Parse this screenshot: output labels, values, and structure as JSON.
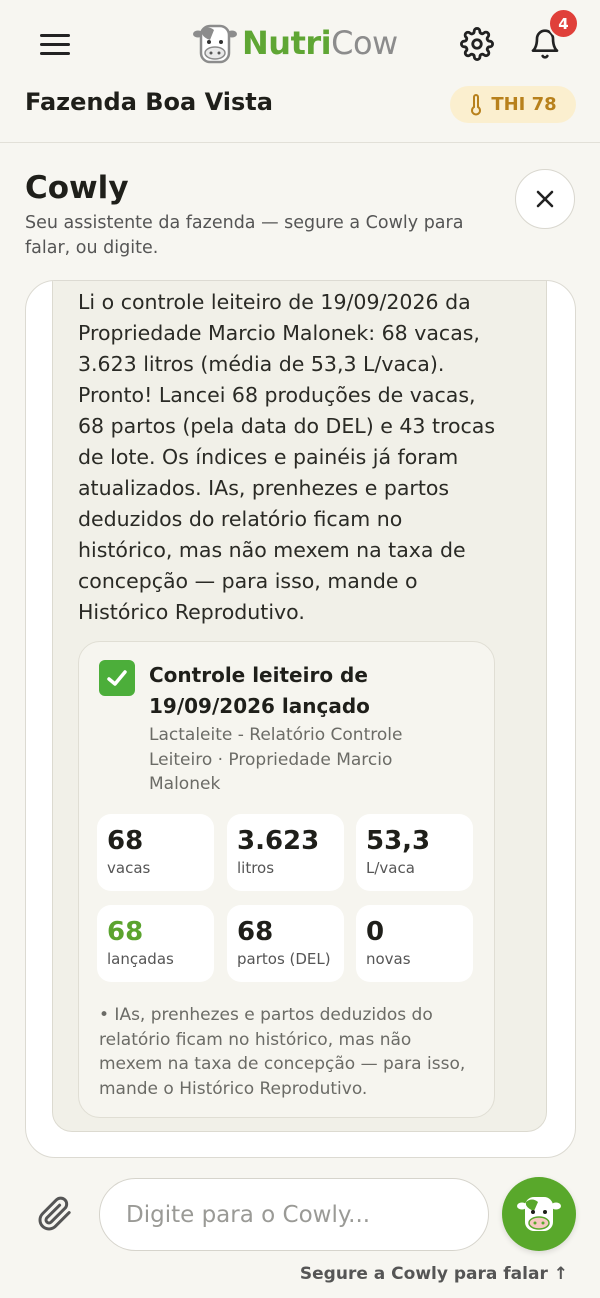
{
  "header": {
    "logo_text_a": "Nutri",
    "logo_text_b": "Cow",
    "notification_count": "4",
    "farm_name": "Fazenda Boa Vista",
    "thi_label": "THI 78"
  },
  "assistant": {
    "title": "Cowly",
    "subtitle": "Seu assistente da fazenda — segure a Cowly para falar, ou digite."
  },
  "message": {
    "text": "Li o controle leiteiro de 19/09/2026 da Propriedade Marcio Malonek: 68 vacas, 3.623 litros (média de 53,3 L/vaca). Pronto! Lancei 68 produções de vacas, 68 partos (pela data do DEL) e 43 trocas de lote. Os índices e painéis já foram atualizados. IAs, prenhezes e partos deduzidos do relatório ficam no histórico, mas não mexem na taxa de concepção — para isso, mande o Histórico Reprodutivo.",
    "card": {
      "title": "Controle leiteiro de 19/09/2026 lançado",
      "subtitle": "Lactaleite - Relatório Controle Leiteiro · Propriedade Marcio Malonek",
      "stats": [
        {
          "value": "68",
          "label": "vacas"
        },
        {
          "value": "3.623",
          "label": "litros"
        },
        {
          "value": "53,3",
          "label": "L/vaca"
        },
        {
          "value": "68",
          "label": "lançadas",
          "accent": "#5ba32e"
        },
        {
          "value": "68",
          "label": "partos (DEL)"
        },
        {
          "value": "0",
          "label": "novas"
        }
      ],
      "note": "• IAs, prenhezes e partos deduzidos do relatório ficam no histórico, mas não mexem na taxa de concepção — para isso, mande o Histórico Reprodutivo."
    }
  },
  "input": {
    "placeholder": "Digite para o Cowly...",
    "hint": "Segure a Cowly para falar ↑"
  },
  "colors": {
    "brand_green": "#59a82b",
    "badge_red": "#e0403a",
    "thi_bg": "#fbefcf",
    "thi_text": "#b8811c"
  }
}
